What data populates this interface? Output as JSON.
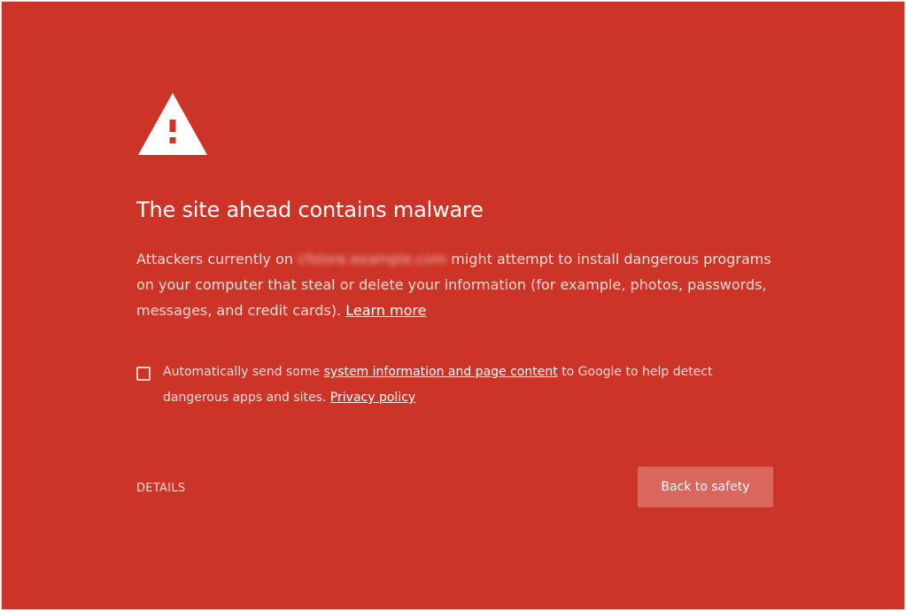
{
  "page": {
    "background_color": "#cd3428",
    "icon": "warning-triangle-icon",
    "title": "The site ahead contains malware",
    "message": {
      "prefix": "Attackers currently on ",
      "blurred_domain": "cfstore.example.com",
      "suffix": " might attempt to install dangerous programs on your computer that steal or delete your information (for example, photos, passwords, messages, and credit cards). ",
      "learn_more_label": "Learn more"
    },
    "report": {
      "checked": false,
      "prefix": "Automatically send some ",
      "link_label": "system information and page content",
      "middle": " to Google to help detect dangerous apps and sites. ",
      "privacy_label": "Privacy policy"
    },
    "details_label": "DETAILS",
    "back_button_label": "Back to safety",
    "button_color": "#d9675e"
  }
}
